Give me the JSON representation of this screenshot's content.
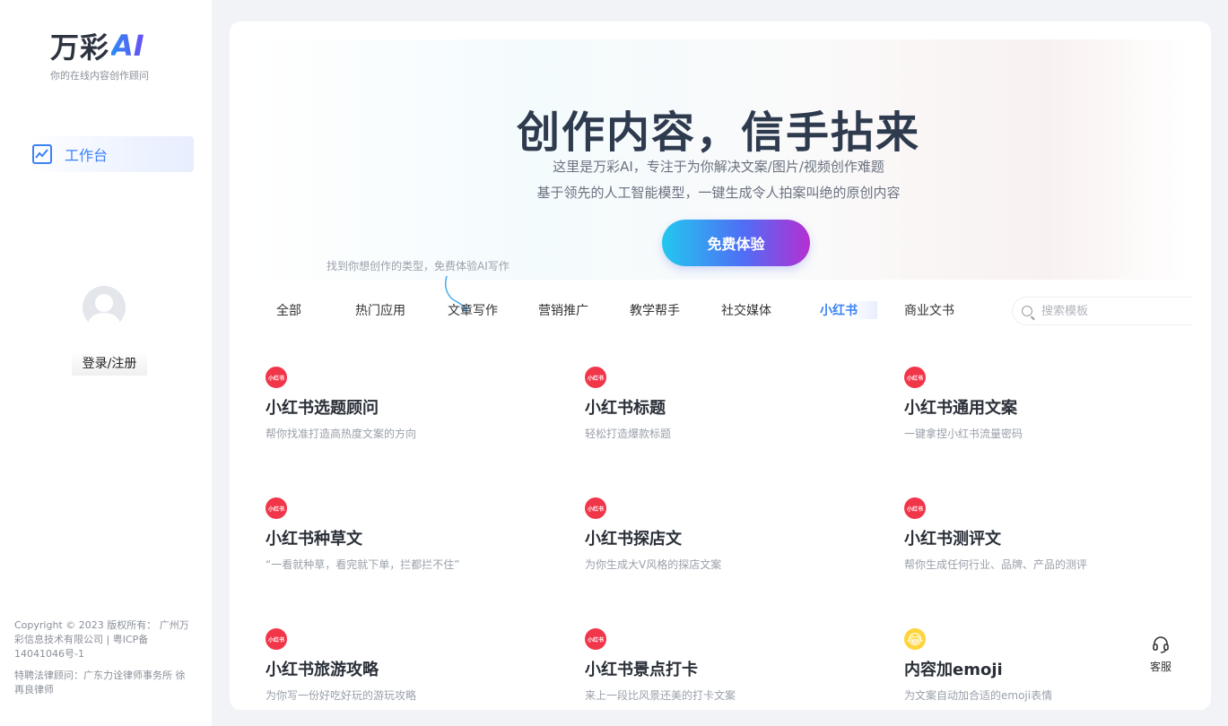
{
  "sidebar": {
    "logo_text": "万彩",
    "logo_ai": "AI",
    "tagline": "你的在线内容创作顾问",
    "nav_items": [
      {
        "label": "工作台",
        "icon": "chart-line-icon",
        "active": true
      }
    ],
    "login_label": "登录/注册",
    "copyright": "Copyright © 2023 版权所有： 广州万彩信息技术有限公司 | 粤ICP备14041046号-1",
    "legal": "特聘法律顾问：广东力诠律师事务所 徐再良律师"
  },
  "hero": {
    "title": "创作内容，信手拈来",
    "subtitle_1": "这里是万彩AI，专注于为你解决文案/图片/视频创作难题",
    "subtitle_2": "基于领先的人工智能模型，一键生成令人拍案叫绝的原创内容",
    "cta_label": "免费体验",
    "hint": "找到你想创作的类型，免费体验AI写作"
  },
  "tabs": [
    {
      "label": "全部",
      "active": false
    },
    {
      "label": "热门应用",
      "active": false
    },
    {
      "label": "文章写作",
      "active": false
    },
    {
      "label": "营销推广",
      "active": false
    },
    {
      "label": "教学帮手",
      "active": false
    },
    {
      "label": "社交媒体",
      "active": false
    },
    {
      "label": "小红书",
      "active": true
    },
    {
      "label": "商业文书",
      "active": false
    }
  ],
  "search": {
    "placeholder": "搜索模板",
    "value": ""
  },
  "cards": [
    {
      "icon_text": "小红书",
      "icon": "xiaohongshu-icon",
      "title": "小红书选题顾问",
      "desc": "帮你找准打造高热度文案的方向"
    },
    {
      "icon_text": "小红书",
      "icon": "xiaohongshu-icon",
      "title": "小红书标题",
      "desc": "轻松打造爆款标题"
    },
    {
      "icon_text": "小红书",
      "icon": "xiaohongshu-icon",
      "title": "小红书通用文案",
      "desc": "一键拿捏小红书流量密码"
    },
    {
      "icon_text": "小红书",
      "icon": "xiaohongshu-icon",
      "title": "小红书种草文",
      "desc": "“一看就种草，看完就下单，拦都拦不住”"
    },
    {
      "icon_text": "小红书",
      "icon": "xiaohongshu-icon",
      "title": "小红书探店文",
      "desc": "为你生成大V风格的探店文案"
    },
    {
      "icon_text": "小红书",
      "icon": "xiaohongshu-icon",
      "title": "小红书测评文",
      "desc": "帮你生成任何行业、品牌、产品的测评"
    },
    {
      "icon_text": "小红书",
      "icon": "xiaohongshu-icon",
      "title": "小红书旅游攻略",
      "desc": "为你写一份好吃好玩的游玩攻略"
    },
    {
      "icon_text": "小红书",
      "icon": "xiaohongshu-icon",
      "title": "小红书景点打卡",
      "desc": "来上一段比风景还美的打卡文案"
    },
    {
      "icon_text": "😂",
      "icon": "emoji-icon",
      "title": "内容加emoji",
      "desc": "为文案自动加合适的emoji表情"
    }
  ],
  "service": {
    "label": "客服",
    "icon": "headset-icon"
  },
  "colors": {
    "accent": "#3b82f6",
    "xhs_red": "#f2364a",
    "title": "#2e3a4d"
  }
}
